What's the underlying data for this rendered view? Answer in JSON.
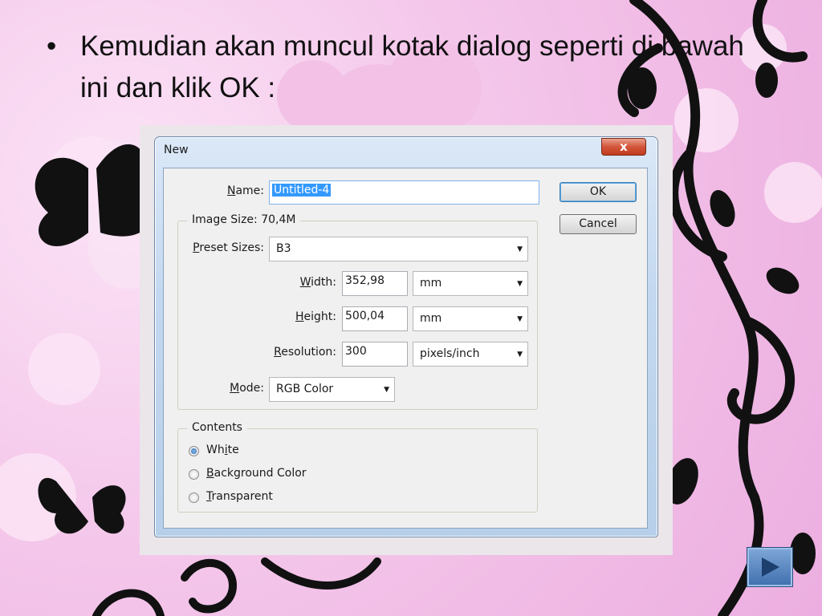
{
  "slide": {
    "bullet": "•",
    "text": "Kemudian akan muncul kotak dialog seperti di bawah ini dan klik OK :"
  },
  "dialog": {
    "title": "New",
    "close_glyph": "x",
    "name_label": {
      "mnemonic": "N",
      "rest": "ame:"
    },
    "name_value": "Untitled-4",
    "ok_label": "OK",
    "cancel_label": "Cancel",
    "image_size": {
      "title": "Image Size:",
      "value": "70,4M"
    },
    "preset_label": {
      "mnemonic": "P",
      "rest": "reset Sizes:"
    },
    "preset_value": "B3",
    "width_label": {
      "mnemonic": "W",
      "rest": "idth:"
    },
    "width_value": "352,98",
    "width_unit": "mm",
    "height_label": {
      "mnemonic": "H",
      "rest": "eight:"
    },
    "height_value": "500,04",
    "height_unit": "mm",
    "resolution_label": {
      "mnemonic": "R",
      "rest": "esolution:"
    },
    "resolution_value": "300",
    "resolution_unit": "pixels/inch",
    "mode_label": {
      "mnemonic": "M",
      "rest": "ode:"
    },
    "mode_value": "RGB Color",
    "contents": {
      "title": "Contents",
      "options": [
        {
          "pre": "Wh",
          "mnemonic": "i",
          "post": "te",
          "checked": true
        },
        {
          "pre": "",
          "mnemonic": "B",
          "post": "ackground Color",
          "checked": false
        },
        {
          "pre": "",
          "mnemonic": "T",
          "post": "ransparent",
          "checked": false
        }
      ]
    }
  },
  "icons": {
    "dropdown": "chevron-down-icon",
    "next": "play-icon"
  },
  "colors": {
    "background": "#f4c6ea",
    "selection": "#3399ff",
    "close_button": "#d3553a",
    "nav_button": "#3f6fae"
  }
}
